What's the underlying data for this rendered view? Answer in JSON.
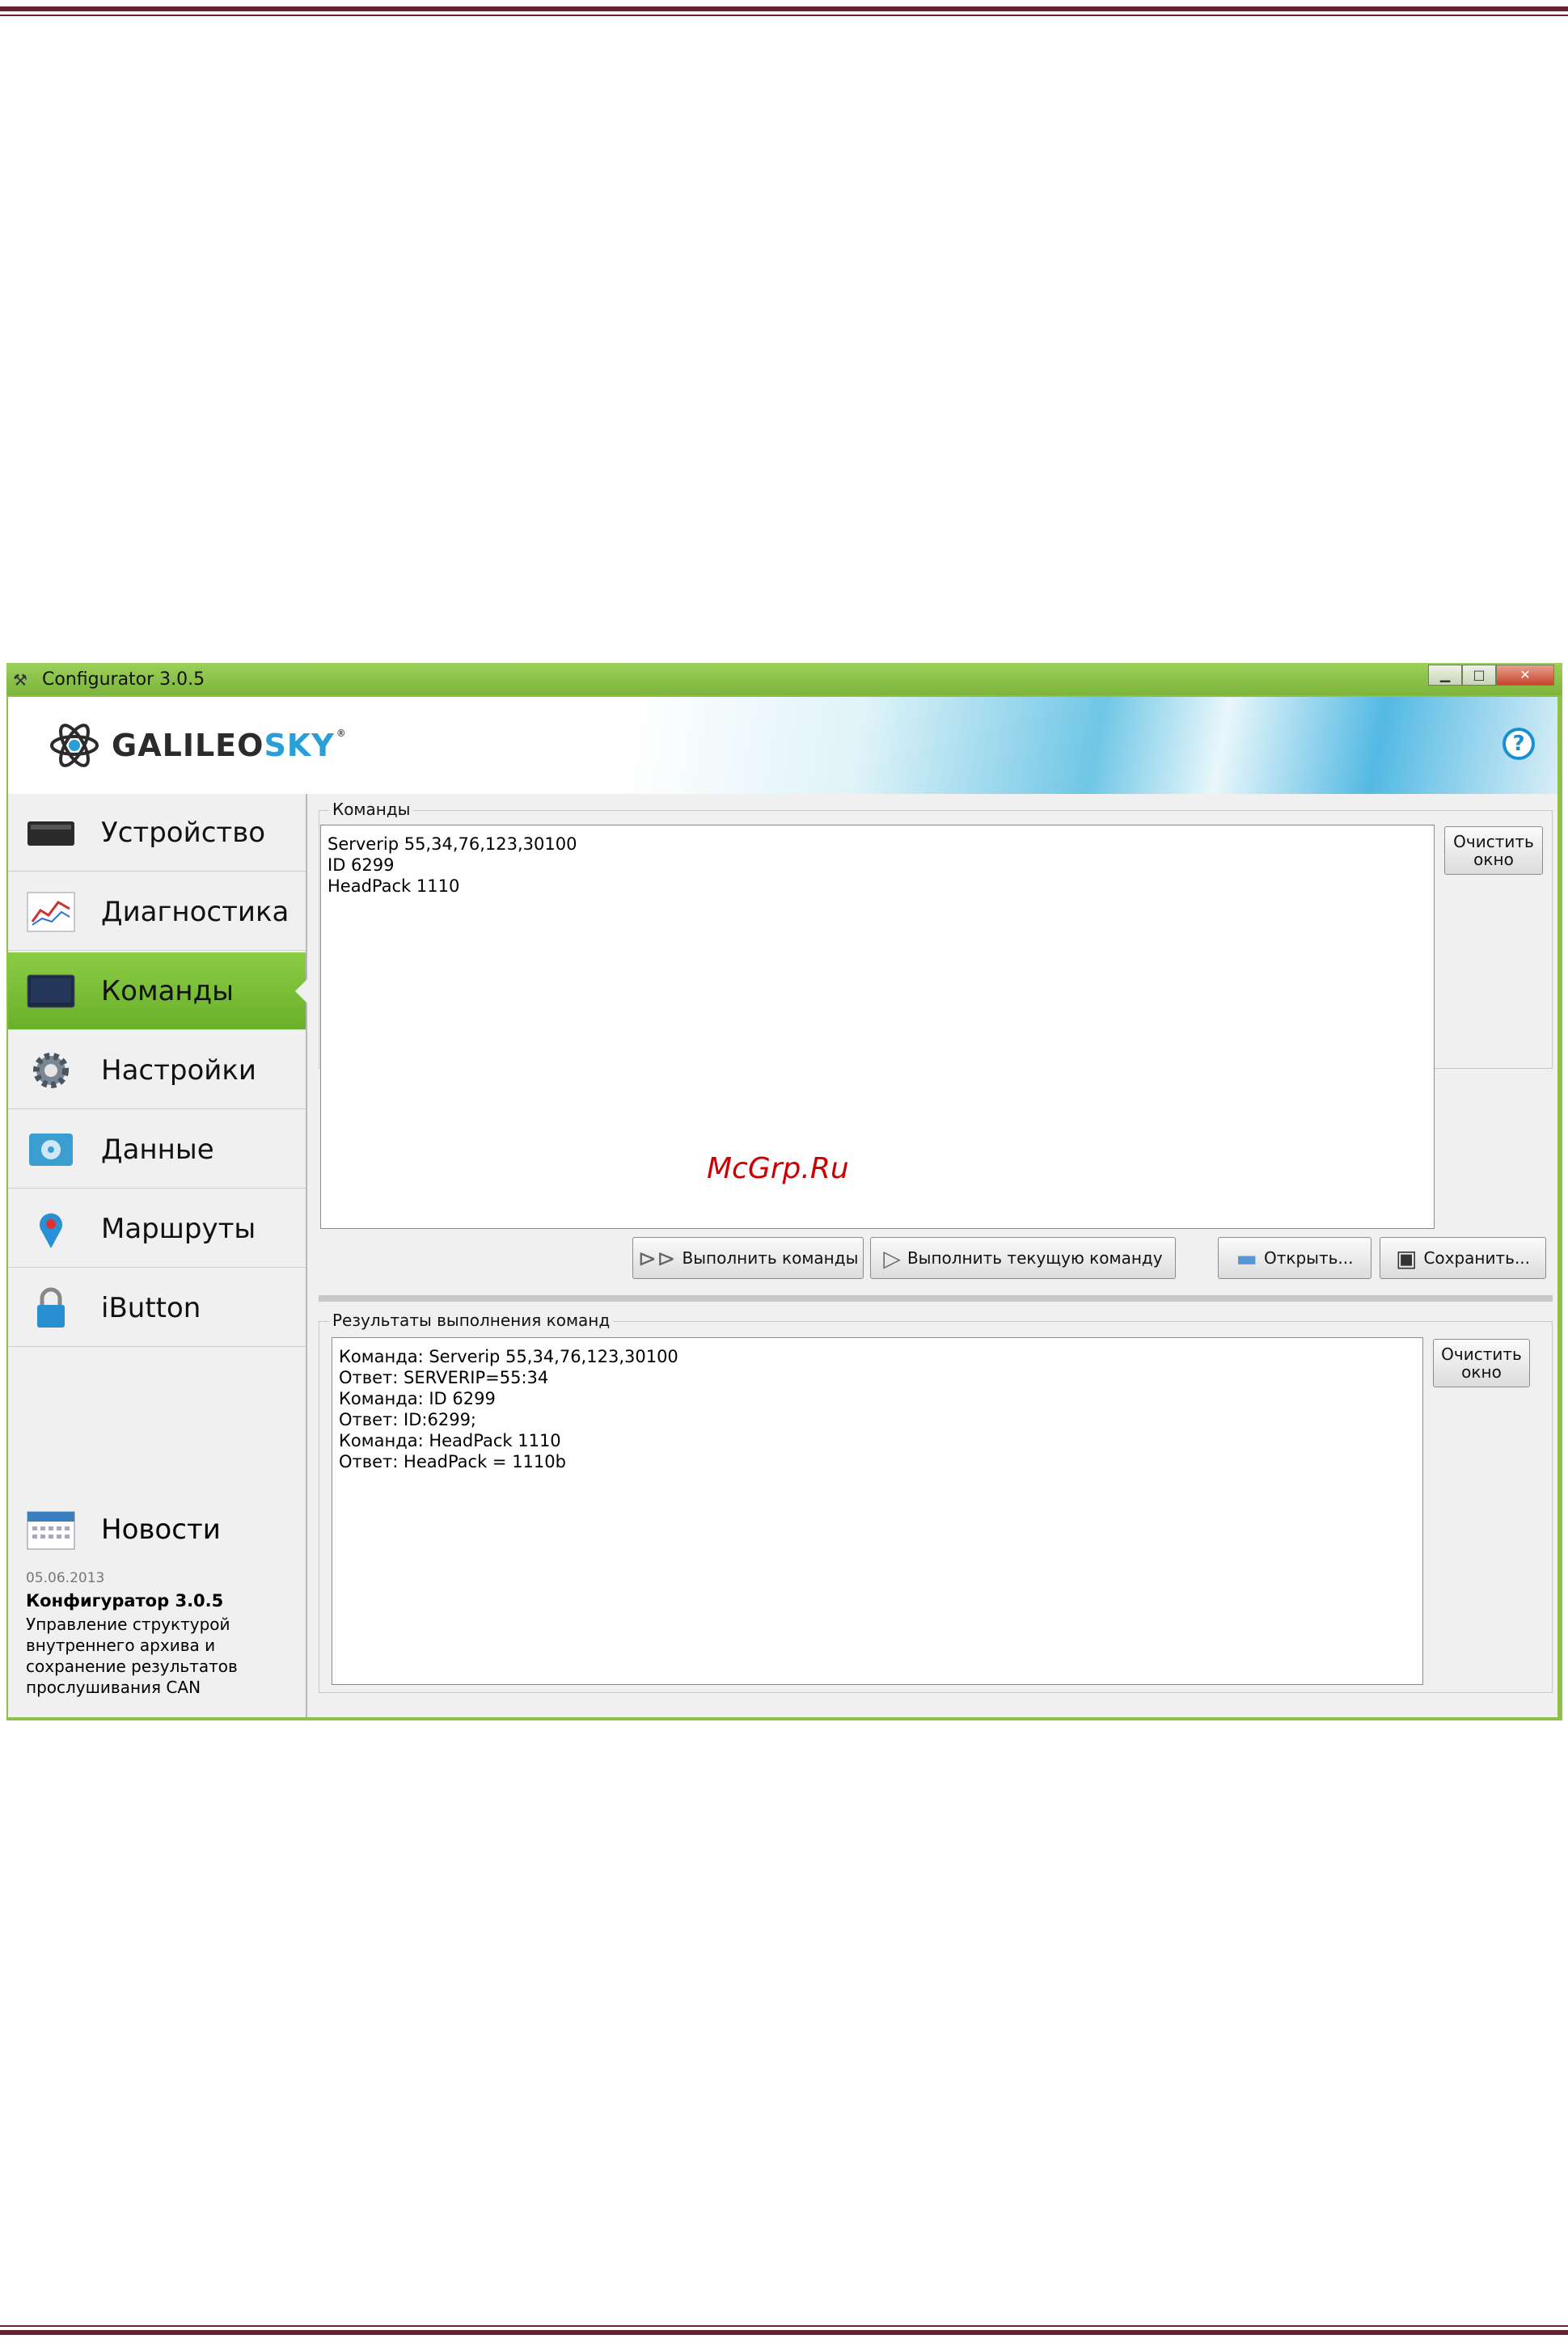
{
  "window": {
    "title": "Configurator 3.0.5",
    "controls": {
      "minimize": "▁",
      "maximize": "□",
      "close": "✕"
    }
  },
  "header": {
    "logo": {
      "part1": "GALILEO",
      "part2": "SKY",
      "reg": "®"
    },
    "help_icon": "?"
  },
  "sidebar": {
    "items": [
      {
        "label": "Устройство",
        "icon": "device-icon"
      },
      {
        "label": "Диагностика",
        "icon": "chart-icon"
      },
      {
        "label": "Команды",
        "icon": "terminal-icon",
        "active": true
      },
      {
        "label": "Настройки",
        "icon": "gear-icon"
      },
      {
        "label": "Данные",
        "icon": "data-icon"
      },
      {
        "label": "Маршруты",
        "icon": "map-pin-icon"
      },
      {
        "label": "iButton",
        "icon": "lock-icon"
      }
    ],
    "news": {
      "title": "Новости",
      "date": "05.06.2013",
      "headline": "Конфигуратор 3.0.5",
      "body": "Управление структурой внутреннего архива и сохранение результатов прослушивания CAN"
    }
  },
  "commands": {
    "group_title": "Команды",
    "text": "Serverip 55,34,76,123,30100\nID 6299\nHeadPack 1110",
    "clear_button": {
      "line1": "Очистить",
      "line2": "окно"
    },
    "run_all_label": "Выполнить команды",
    "run_current_label": "Выполнить текущую команду",
    "open_label": "Открыть...",
    "save_label": "Сохранить..."
  },
  "results": {
    "group_title": "Результаты выполнения команд",
    "text": "Команда: Serverip 55,34,76,123,30100\nОтвет: SERVERIP=55:34\nКоманда: ID 6299\nОтвет: ID:6299;\nКоманда: HeadPack 1110\nОтвет: HeadPack = 1110b",
    "clear_button": {
      "line1": "Очистить",
      "line2": "окно"
    }
  },
  "watermark": "McGrp.Ru",
  "colors": {
    "accent_green": "#7db43b",
    "brand_blue": "#2a9fd6",
    "rule": "#6b2030"
  }
}
